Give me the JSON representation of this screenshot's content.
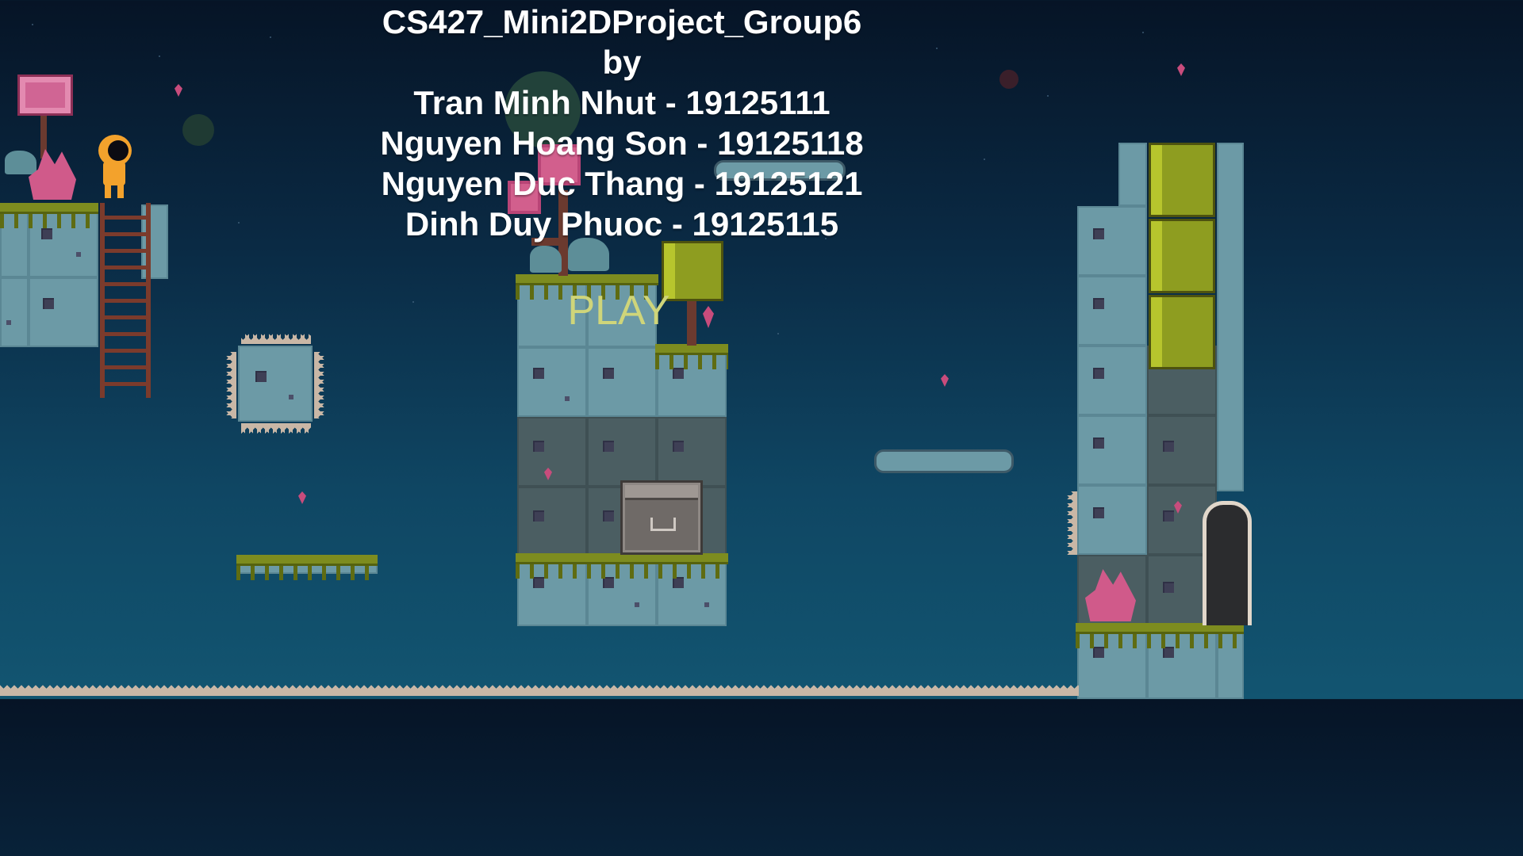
{
  "game": {
    "title_lines": [
      "CS427_Mini2DProject_Group6",
      "by",
      "Tran Minh Nhut - 19125111",
      "Nguyen Hoang Son - 19125118",
      "Nguyen Duc Thang - 19125121",
      "Dinh Duy Phuoc - 19125115"
    ],
    "play_label": "PLAY"
  },
  "colors": {
    "sky_top": "#061426",
    "sky_bottom": "#125571",
    "play_text": "#cfd57a",
    "title_text": "#ffffff"
  },
  "icons": [
    "player-character-icon",
    "gem-icon",
    "crystal-icon",
    "spike-icon",
    "crate-icon",
    "door-icon",
    "sign-icon",
    "ladder-icon"
  ]
}
